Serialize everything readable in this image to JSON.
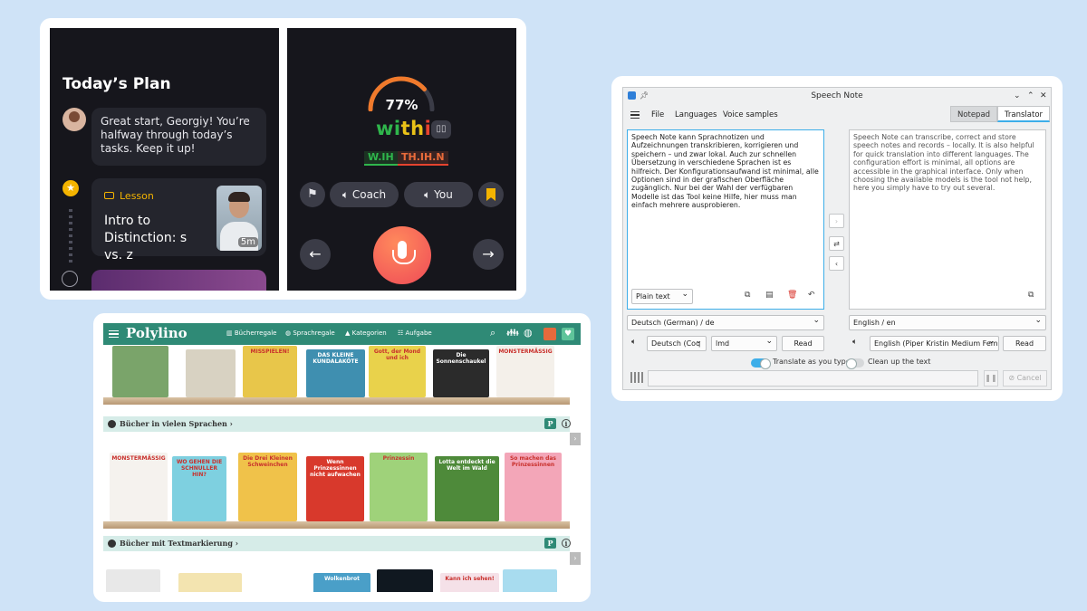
{
  "learning_app": {
    "plan": {
      "title": "Today’s Plan",
      "message": "Great start, Georgiy! You’re halfway through today’s tasks. Keep it up!",
      "lesson_tag": "Lesson",
      "lesson_title": "Intro to Distinction: s vs. z",
      "lesson_duration": "5m"
    },
    "practice": {
      "score_percent": 77,
      "score_label": "77%",
      "word_parts": [
        "wi",
        "th",
        "in"
      ],
      "phoneme_1": "W.IH",
      "phoneme_2": "TH.IH.N",
      "coach_label": "Coach",
      "you_label": "You"
    }
  },
  "speech_note": {
    "window_title": "Speech Note",
    "menu": [
      "File",
      "Languages",
      "Voice samples"
    ],
    "tabs": [
      "Notepad",
      "Translator"
    ],
    "active_tab": "Translator",
    "source_text": "Speech Note kann Sprachnotizen und Aufzeichnungen transkribieren, korrigieren und speichern – und zwar lokal. Auch zur schnellen Übersetzung in verschiedene Sprachen ist es hilfreich. Der Konfigurationsaufwand ist minimal, alle Optionen sind in der grafischen Oberfläche zugänglich. Nur bei der Wahl der verfügbaren Modelle ist das Tool keine Hilfe, hier muss man einfach mehrere ausprobieren.",
    "translated_text": "Speech Note can transcribe, correct and store speech notes and records – locally. It is also helpful for quick translation into different languages. The configuration effort is minimal, all options are accessible in the graphical interface. Only when choosing the available models is the tool not help, here you simply have to try out several.",
    "format_select": "Plain text",
    "source_language": "Deutsch (German) / de",
    "target_language": "English / en",
    "source_voice": "Deutsch (Coq",
    "source_model": "lmd",
    "target_voice": "English (Piper Kristin Medium Fema",
    "read_label": "Read",
    "translate_toggle_label": "Translate as you type",
    "cleanup_toggle_label": "Clean up the text",
    "cancel_label": "Cancel"
  },
  "polylino": {
    "logo": "Polylino",
    "nav": [
      "Bücherregale",
      "Sprachregale",
      "Kategorien",
      "Aufgabe"
    ],
    "section_1": "Bücher in vielen Sprachen",
    "section_2": "Bücher mit Textmarkierung",
    "badge_p": "P",
    "badge_i": "i",
    "books_row1": [
      "",
      "",
      "MISSPIELEN!",
      "DAS KLEINE KUNDALAKÖTE",
      "Gott, der Mond und ich",
      "Die Sonnenschaukel",
      "MONSTERMÄSSIG"
    ],
    "books_row2": [
      "MONSTERMÄSSIG",
      "WO GEHEN DIE SCHNULLER HIN?",
      "Die Drei Kleinen Schweinchen",
      "Wenn Prinzessinnen nicht aufwachen",
      "Prinzessin",
      "Lotta entdeckt die Welt im Wald",
      "So machen das Prinzessinnen"
    ],
    "books_row3": [
      "",
      "",
      "",
      "Wolkenbrot",
      "",
      "Kann ich sehen!",
      ""
    ]
  },
  "colors": {
    "background": "#cfe3f7",
    "polylino_brand": "#2f8a76",
    "speech_note_accent": "#3daee9",
    "mic_button": "#ef4a57"
  }
}
